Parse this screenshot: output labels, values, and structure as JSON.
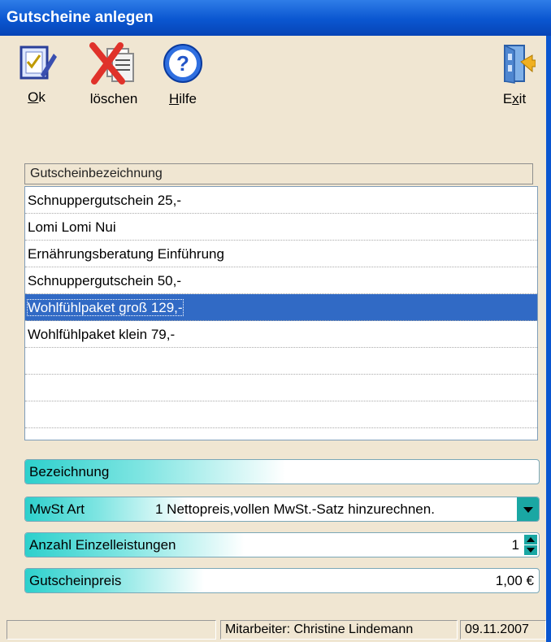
{
  "window": {
    "title": "Gutscheine anlegen"
  },
  "toolbar": {
    "ok": {
      "label_u": "O",
      "label_rest": "k",
      "icon": "checklist-pen-icon"
    },
    "delete": {
      "label": "löschen",
      "icon": "delete-document-icon"
    },
    "help": {
      "label_u": "H",
      "label_rest": "ilfe",
      "icon": "help-icon"
    },
    "exit": {
      "label_pre": "E",
      "label_u": "x",
      "label_rest": "it",
      "icon": "exit-door-icon"
    }
  },
  "list": {
    "column_header": "Gutscheinbezeichnung",
    "rows": [
      "Schnuppergutschein 25,-",
      "Lomi Lomi Nui",
      "Ernährungsberatung Einführung",
      "Schnuppergutschein 50,-",
      "Wohlfühlpaket groß 129,-",
      "Wohlfühlpaket klein 79,-"
    ],
    "selected_index": 4
  },
  "form": {
    "bezeichnung": {
      "label": "Bezeichnung",
      "value": ""
    },
    "mwst_art": {
      "label": "MwSt Art",
      "value": "1 Nettopreis,vollen MwSt.-Satz hinzurechnen."
    },
    "anzahl": {
      "label": "Anzahl Einzelleistungen",
      "value": "1"
    },
    "preis": {
      "label": "Gutscheinpreis",
      "value": "1,00 €"
    }
  },
  "statusbar": {
    "left": "",
    "employee": "Mitarbeiter:  Christine Lindemann",
    "date": "09.11.2007"
  },
  "colors": {
    "title": "#0a56d0",
    "selection": "#316ac5",
    "accent": "#1aa7a3",
    "background": "#f0e6d2"
  }
}
